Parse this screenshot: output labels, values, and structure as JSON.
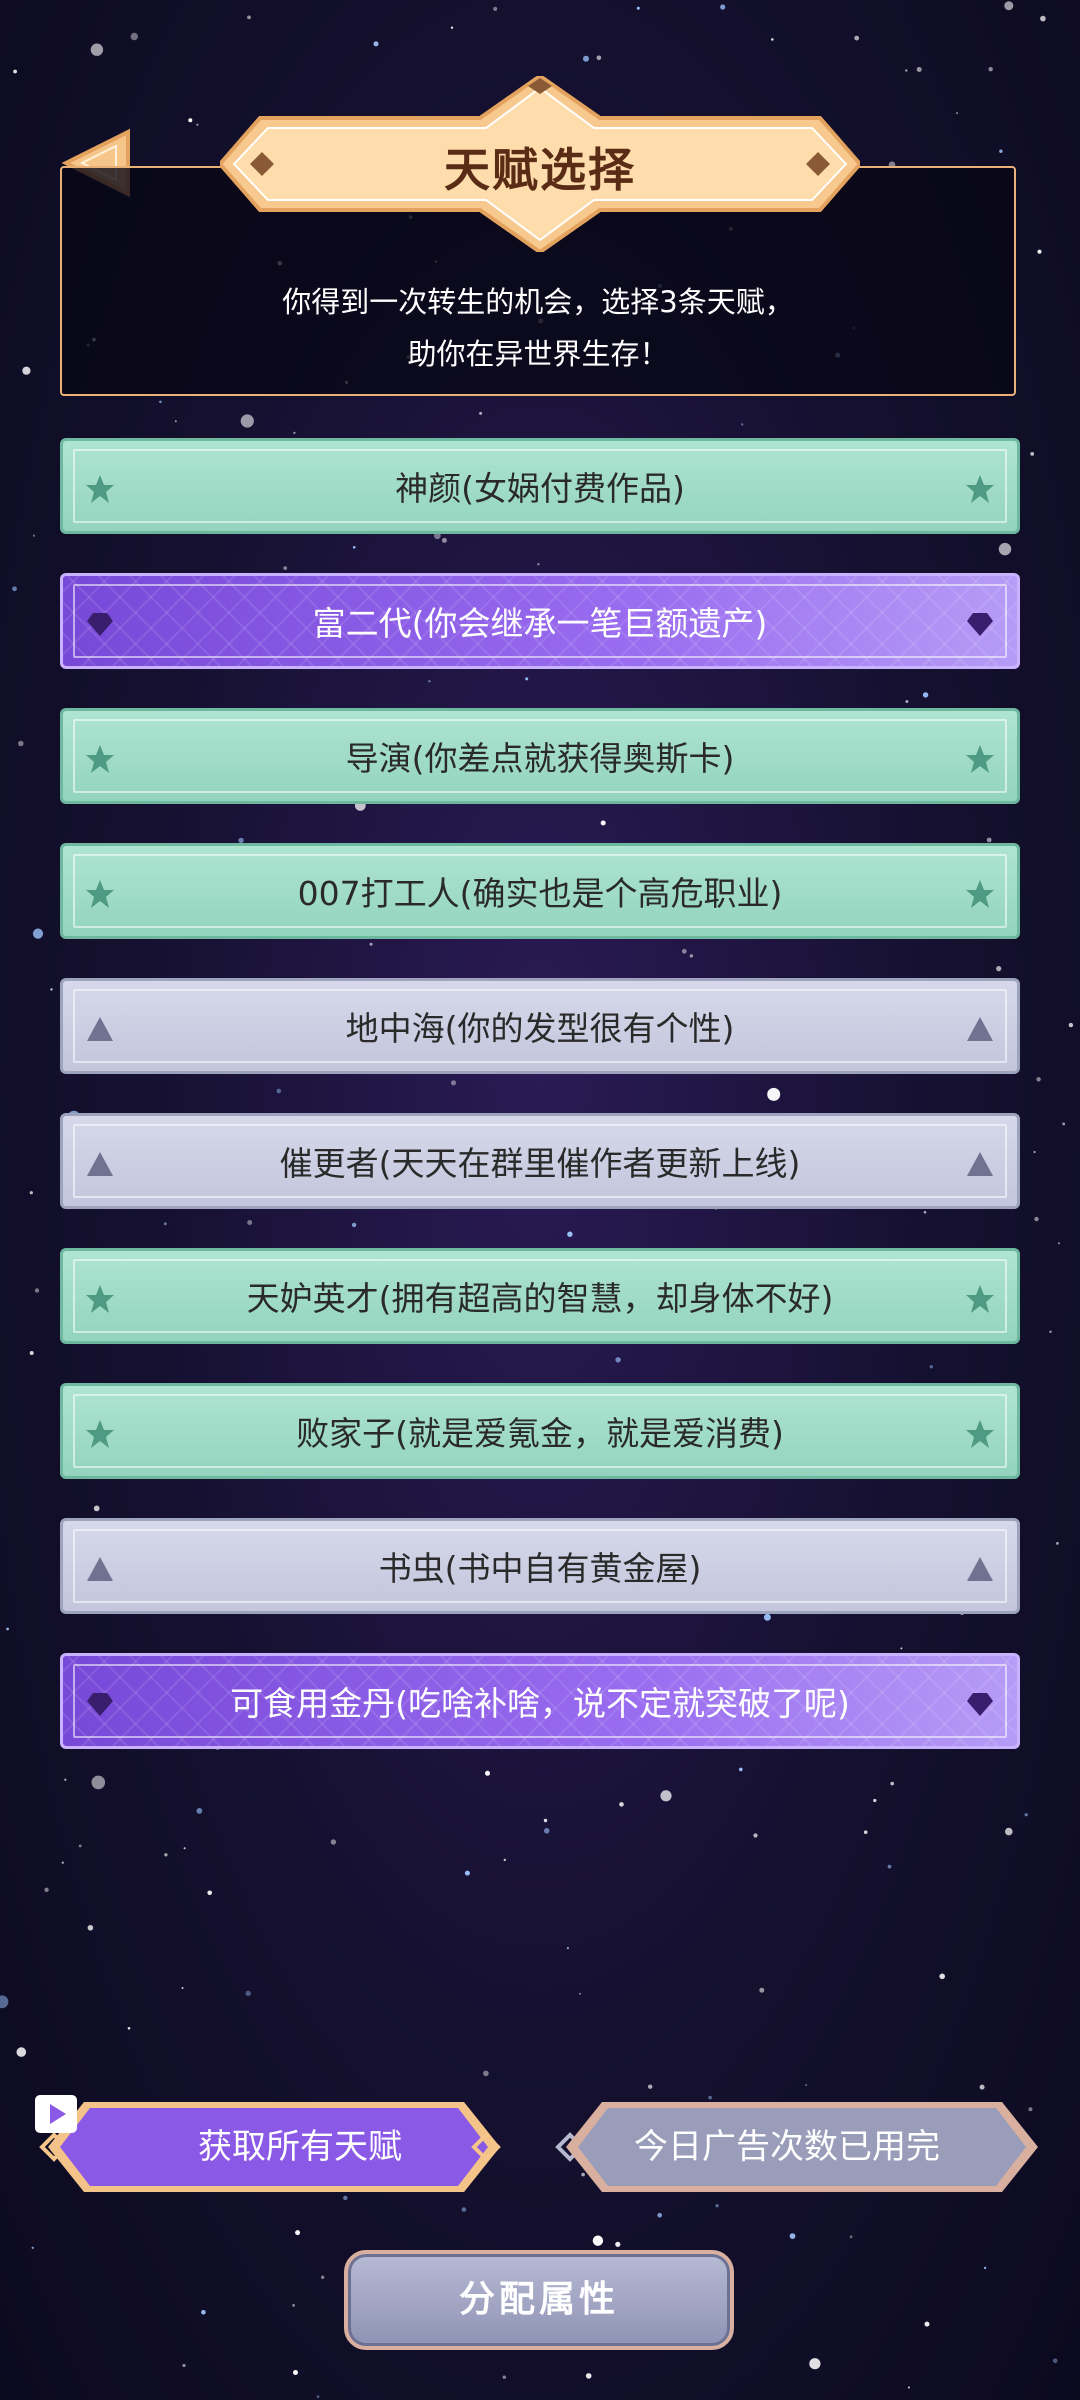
{
  "header": {
    "title": "天赋选择",
    "description_lines": [
      "你得到一次转生的机会，选择3条天赋，",
      "助你在异世界生存！"
    ]
  },
  "talents": [
    {
      "label": "神颜(女娲付费作品)",
      "rarity": "green",
      "icon": "star-icon"
    },
    {
      "label": "富二代(你会继承一笔巨额遗产)",
      "rarity": "purple",
      "icon": "diamond-icon"
    },
    {
      "label": "导演(你差点就获得奥斯卡)",
      "rarity": "green",
      "icon": "star-icon"
    },
    {
      "label": "007打工人(确实也是个高危职业)",
      "rarity": "green",
      "icon": "star-icon"
    },
    {
      "label": "地中海(你的发型很有个性)",
      "rarity": "gray",
      "icon": "triangle-icon"
    },
    {
      "label": "催更者(天天在群里催作者更新上线)",
      "rarity": "gray",
      "icon": "triangle-icon"
    },
    {
      "label": "天妒英才(拥有超高的智慧，却身体不好)",
      "rarity": "green",
      "icon": "star-icon"
    },
    {
      "label": "败家子(就是爱氪金，就是爱消费)",
      "rarity": "green",
      "icon": "star-icon"
    },
    {
      "label": "书虫(书中自有黄金屋)",
      "rarity": "gray",
      "icon": "triangle-icon"
    },
    {
      "label": "可食用金丹(吃啥补啥，说不定就突破了呢)",
      "rarity": "purple",
      "icon": "diamond-icon"
    }
  ],
  "buttons": {
    "get_all_talents": "获取所有天赋",
    "ads_used_up": "今日广告次数已用完",
    "allocate_attributes": "分配属性"
  },
  "colors": {
    "green": "#a4ddc9",
    "purple": "#8a5ae6",
    "gray": "#cfd1e4",
    "title_banner": "#f6c58a",
    "panel_border": "#e9b178"
  }
}
